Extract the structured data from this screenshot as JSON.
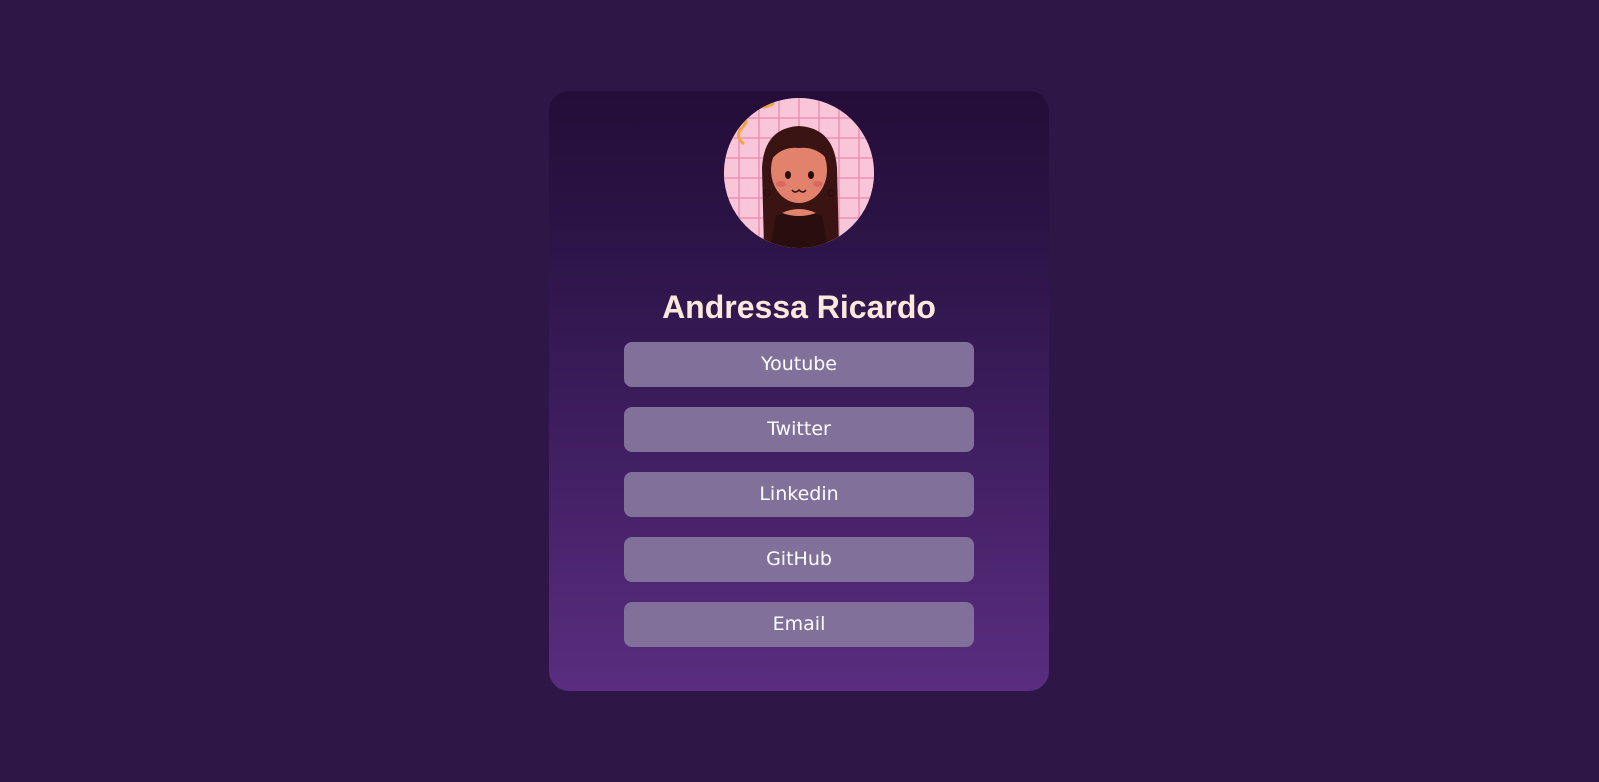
{
  "profile": {
    "name": "Andressa Ricardo",
    "avatar": "avatar-illustration"
  },
  "links": [
    {
      "label": "Youtube"
    },
    {
      "label": "Twitter"
    },
    {
      "label": "Linkedin"
    },
    {
      "label": "GitHub"
    },
    {
      "label": "Email"
    }
  ],
  "colors": {
    "background": "#2e1746",
    "card_top": "#240d38",
    "card_bottom": "#5a2d80",
    "button": "#80709a",
    "name_text": "#fde8dc",
    "button_text": "#ffffff"
  }
}
